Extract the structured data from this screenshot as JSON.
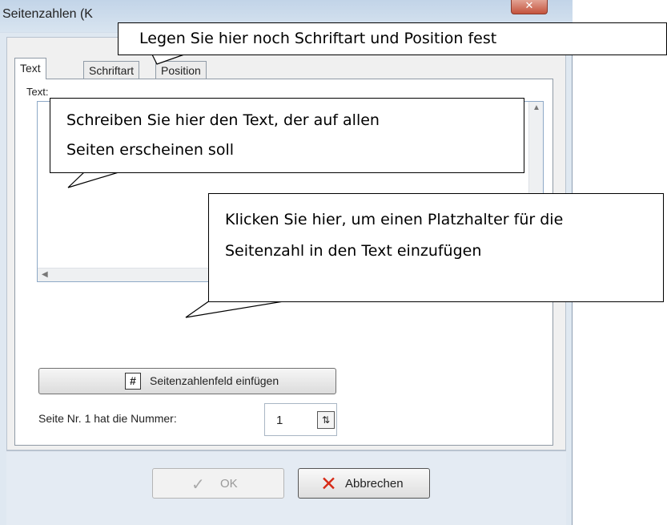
{
  "window": {
    "title": "Seitenzahlen (K",
    "close_symbol": "✕"
  },
  "tabs": [
    {
      "label": "Text",
      "active": true
    },
    {
      "label": "Schriftart",
      "active": false
    },
    {
      "label": "Position",
      "active": false
    }
  ],
  "text_section": {
    "label": "Text:",
    "value": ""
  },
  "insert_button": {
    "label": "Seitenzahlenfeld einfügen",
    "icon": "hash-icon",
    "icon_glyph": "#"
  },
  "page_number": {
    "label": "Seite Nr. 1 hat die Nummer:",
    "value": "1"
  },
  "footer": {
    "ok_label": "OK",
    "ok_enabled": false,
    "cancel_label": "Abbrechen"
  },
  "callouts": {
    "top": "Legen Sie hier noch Schriftart und Position fest",
    "text_area_line1": "Schreiben Sie hier den Text, der auf allen",
    "text_area_line2": "Seiten erscheinen soll",
    "button_line1": "Klicken Sie hier, um einen Platzhalter für die",
    "button_line2": "Seitenzahl in den Text einzufügen"
  },
  "colors": {
    "cancel_icon": "#d72a16",
    "close_button": "#c4533d"
  }
}
